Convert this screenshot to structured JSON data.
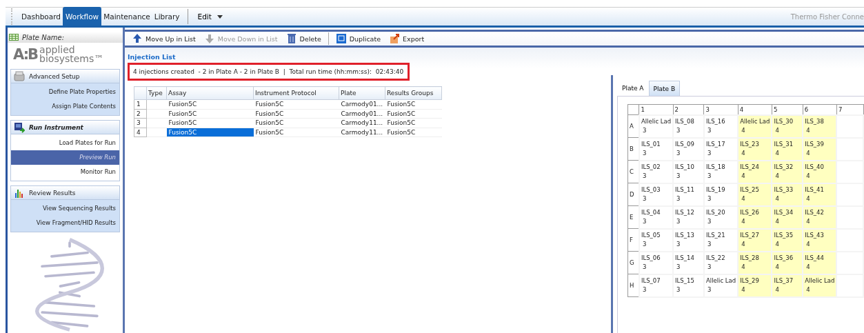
{
  "menu_bar": {
    "tabs": [
      {
        "label": "Dashboard",
        "selected": false
      },
      {
        "label": "Workflow",
        "selected": true
      },
      {
        "label": "Maintenance",
        "selected": false
      },
      {
        "label": "Library",
        "selected": false
      }
    ],
    "edit_menu": "Edit",
    "brand_text": "Thermo Fisher Conne"
  },
  "sidebar": {
    "plate_name_label": "Plate Name:",
    "logo": {
      "mark": "A:B",
      "line_1": "applied",
      "line_2": "biosystems™"
    },
    "sections": [
      {
        "title": "Advanced Setup",
        "active": false,
        "items": [
          {
            "label": "Define Plate Properties",
            "selected": false
          },
          {
            "label": "Assign Plate Contents",
            "selected": false
          }
        ]
      },
      {
        "title": "Run Instrument",
        "active": true,
        "items": [
          {
            "label": "Load Plates for Run",
            "selected": false
          },
          {
            "label": "Preview Run",
            "selected": true
          },
          {
            "label": "Monitor Run",
            "selected": false
          }
        ]
      },
      {
        "title": "Review Results",
        "active": false,
        "items": [
          {
            "label": "View  Sequencing Results",
            "selected": false
          },
          {
            "label": "View  Fragment/HID Results",
            "selected": false
          }
        ]
      }
    ]
  },
  "toolbar": [
    {
      "label": "Move Up in List",
      "disabled": false
    },
    {
      "label": "Move Down in List",
      "disabled": true
    },
    {
      "label": "Delete",
      "disabled": false
    },
    {
      "label": "Duplicate",
      "disabled": false
    },
    {
      "label": "Export",
      "disabled": false
    }
  ],
  "injection_list": {
    "title": "Injection List",
    "summary": "4 injections created  - 2 in Plate A - 2 in Plate B  |  Total run time (hh:mm:ss):  02:43:40",
    "columns": [
      "Type",
      "Assay",
      "Instrument Protocol",
      "Plate",
      "Results Groups"
    ],
    "rows": [
      {
        "number": "1",
        "cells": [
          "",
          "Fusion5C",
          "Fusion5C",
          "Carmody01...",
          "Fusion5C"
        ],
        "selected": false
      },
      {
        "number": "2",
        "cells": [
          "",
          "Fusion5C",
          "Fusion5C",
          "Carmody01...",
          "Fusion5C"
        ],
        "selected": false
      },
      {
        "number": "3",
        "cells": [
          "",
          "Fusion5C",
          "Fusion5C",
          "Carmody11...",
          "Fusion5C"
        ],
        "selected": false
      },
      {
        "number": "4",
        "cells": [
          "",
          "Fusion5C",
          "Fusion5C",
          "Carmody11...",
          "Fusion5C"
        ],
        "selected": true
      }
    ]
  },
  "plate_view": {
    "tabs": [
      {
        "label": "Plate A",
        "selected": false
      },
      {
        "label": "Plate B",
        "selected": true
      }
    ],
    "columns": [
      "1",
      "2",
      "3",
      "4",
      "5",
      "6",
      "7"
    ],
    "rows": [
      {
        "label": "A",
        "cells": [
          {
            "name": "Allelic Lad",
            "number": "3",
            "highlighted": false
          },
          {
            "name": "ILS_08",
            "number": "3",
            "highlighted": false
          },
          {
            "name": "ILS_16",
            "number": "3",
            "highlighted": false
          },
          {
            "name": "Allelic Lad",
            "number": "4",
            "highlighted": true
          },
          {
            "name": "ILS_30",
            "number": "4",
            "highlighted": true
          },
          {
            "name": "ILS_38",
            "number": "4",
            "highlighted": true
          }
        ]
      },
      {
        "label": "B",
        "cells": [
          {
            "name": "ILS_01",
            "number": "3",
            "highlighted": false
          },
          {
            "name": "ILS_09",
            "number": "3",
            "highlighted": false
          },
          {
            "name": "ILS_17",
            "number": "3",
            "highlighted": false
          },
          {
            "name": "ILS_23",
            "number": "4",
            "highlighted": true
          },
          {
            "name": "ILS_31",
            "number": "4",
            "highlighted": true
          },
          {
            "name": "ILS_39",
            "number": "4",
            "highlighted": true
          }
        ]
      },
      {
        "label": "C",
        "cells": [
          {
            "name": "ILS_02",
            "number": "3",
            "highlighted": false
          },
          {
            "name": "ILS_10",
            "number": "3",
            "highlighted": false
          },
          {
            "name": "ILS_18",
            "number": "3",
            "highlighted": false
          },
          {
            "name": "ILS_24",
            "number": "4",
            "highlighted": true
          },
          {
            "name": "ILS_32",
            "number": "4",
            "highlighted": true
          },
          {
            "name": "ILS_40",
            "number": "4",
            "highlighted": true
          }
        ]
      },
      {
        "label": "D",
        "cells": [
          {
            "name": "ILS_03",
            "number": "3",
            "highlighted": false
          },
          {
            "name": "ILS_11",
            "number": "3",
            "highlighted": false
          },
          {
            "name": "ILS_19",
            "number": "3",
            "highlighted": false
          },
          {
            "name": "ILS_25",
            "number": "4",
            "highlighted": true
          },
          {
            "name": "ILS_33",
            "number": "4",
            "highlighted": true
          },
          {
            "name": "ILS_41",
            "number": "4",
            "highlighted": true
          }
        ]
      },
      {
        "label": "E",
        "cells": [
          {
            "name": "ILS_04",
            "number": "3",
            "highlighted": false
          },
          {
            "name": "ILS_12",
            "number": "3",
            "highlighted": false
          },
          {
            "name": "ILS_20",
            "number": "3",
            "highlighted": false
          },
          {
            "name": "ILS_26",
            "number": "4",
            "highlighted": true
          },
          {
            "name": "ILS_34",
            "number": "4",
            "highlighted": true
          },
          {
            "name": "ILS_42",
            "number": "4",
            "highlighted": true
          }
        ]
      },
      {
        "label": "F",
        "cells": [
          {
            "name": "ILS_05",
            "number": "3",
            "highlighted": false
          },
          {
            "name": "ILS_13",
            "number": "3",
            "highlighted": false
          },
          {
            "name": "ILS_21",
            "number": "3",
            "highlighted": false
          },
          {
            "name": "ILS_27",
            "number": "4",
            "highlighted": true
          },
          {
            "name": "ILS_35",
            "number": "4",
            "highlighted": true
          },
          {
            "name": "ILS_43",
            "number": "4",
            "highlighted": true
          }
        ]
      },
      {
        "label": "G",
        "cells": [
          {
            "name": "ILS_06",
            "number": "3",
            "highlighted": false
          },
          {
            "name": "ILS_14",
            "number": "3",
            "highlighted": false
          },
          {
            "name": "ILS_22",
            "number": "3",
            "highlighted": false
          },
          {
            "name": "ILS_28",
            "number": "4",
            "highlighted": true
          },
          {
            "name": "ILS_36",
            "number": "4",
            "highlighted": true
          },
          {
            "name": "ILS_44",
            "number": "4",
            "highlighted": true
          }
        ]
      },
      {
        "label": "H",
        "cells": [
          {
            "name": "ILS_07",
            "number": "3",
            "highlighted": false
          },
          {
            "name": "ILS_15",
            "number": "3",
            "highlighted": false
          },
          {
            "name": "Allelic Lad",
            "number": "3",
            "highlighted": false
          },
          {
            "name": "ILS_29",
            "number": "4",
            "highlighted": true
          },
          {
            "name": "ILS_37",
            "number": "4",
            "highlighted": true
          },
          {
            "name": "Allelic Lad",
            "number": "4",
            "highlighted": true
          }
        ]
      }
    ]
  }
}
